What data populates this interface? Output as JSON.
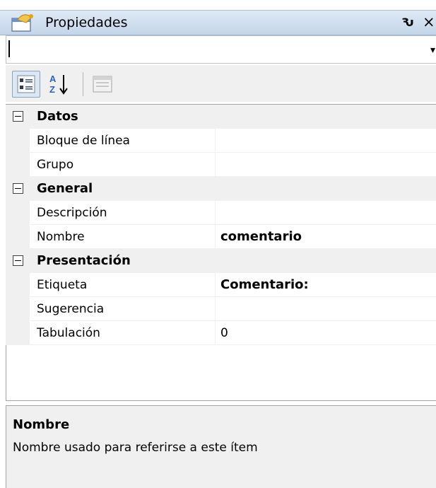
{
  "window": {
    "title": "Propiedades",
    "title_icon": "properties-window-icon",
    "pin_icon": "pin-icon",
    "pin_glyph": "Ԅ",
    "close_glyph": "×"
  },
  "object_selector": {
    "value": "",
    "arrow_glyph": "▾"
  },
  "toolbar": {
    "buttons": [
      {
        "name": "categorized-view-button",
        "icon": "categorized-icon",
        "active": true
      },
      {
        "name": "alphabetical-sort-button",
        "icon": "sort-az-icon",
        "active": false
      },
      {
        "name": "property-pages-button",
        "icon": "property-pages-icon",
        "enabled": false
      }
    ]
  },
  "grid": {
    "categories": [
      {
        "label": "Datos",
        "expanded": true,
        "properties": [
          {
            "name": "Bloque de línea",
            "value": ""
          },
          {
            "name": "Grupo",
            "value": ""
          }
        ]
      },
      {
        "label": "General",
        "expanded": true,
        "properties": [
          {
            "name": "Descripción",
            "value": ""
          },
          {
            "name": "Nombre",
            "value": "comentario"
          }
        ]
      },
      {
        "label": "Presentación",
        "expanded": true,
        "properties": [
          {
            "name": "Etiqueta",
            "value": "Comentario:"
          },
          {
            "name": "Sugerencia",
            "value": ""
          },
          {
            "name": "Tabulación",
            "value": "0"
          }
        ]
      }
    ]
  },
  "description": {
    "title": "Nombre",
    "text": "Nombre usado para referirse a este ítem"
  },
  "colors": {
    "titlebar": "#c4d5ea",
    "margin": "#f0f0f0",
    "border": "#a3a3a3"
  }
}
